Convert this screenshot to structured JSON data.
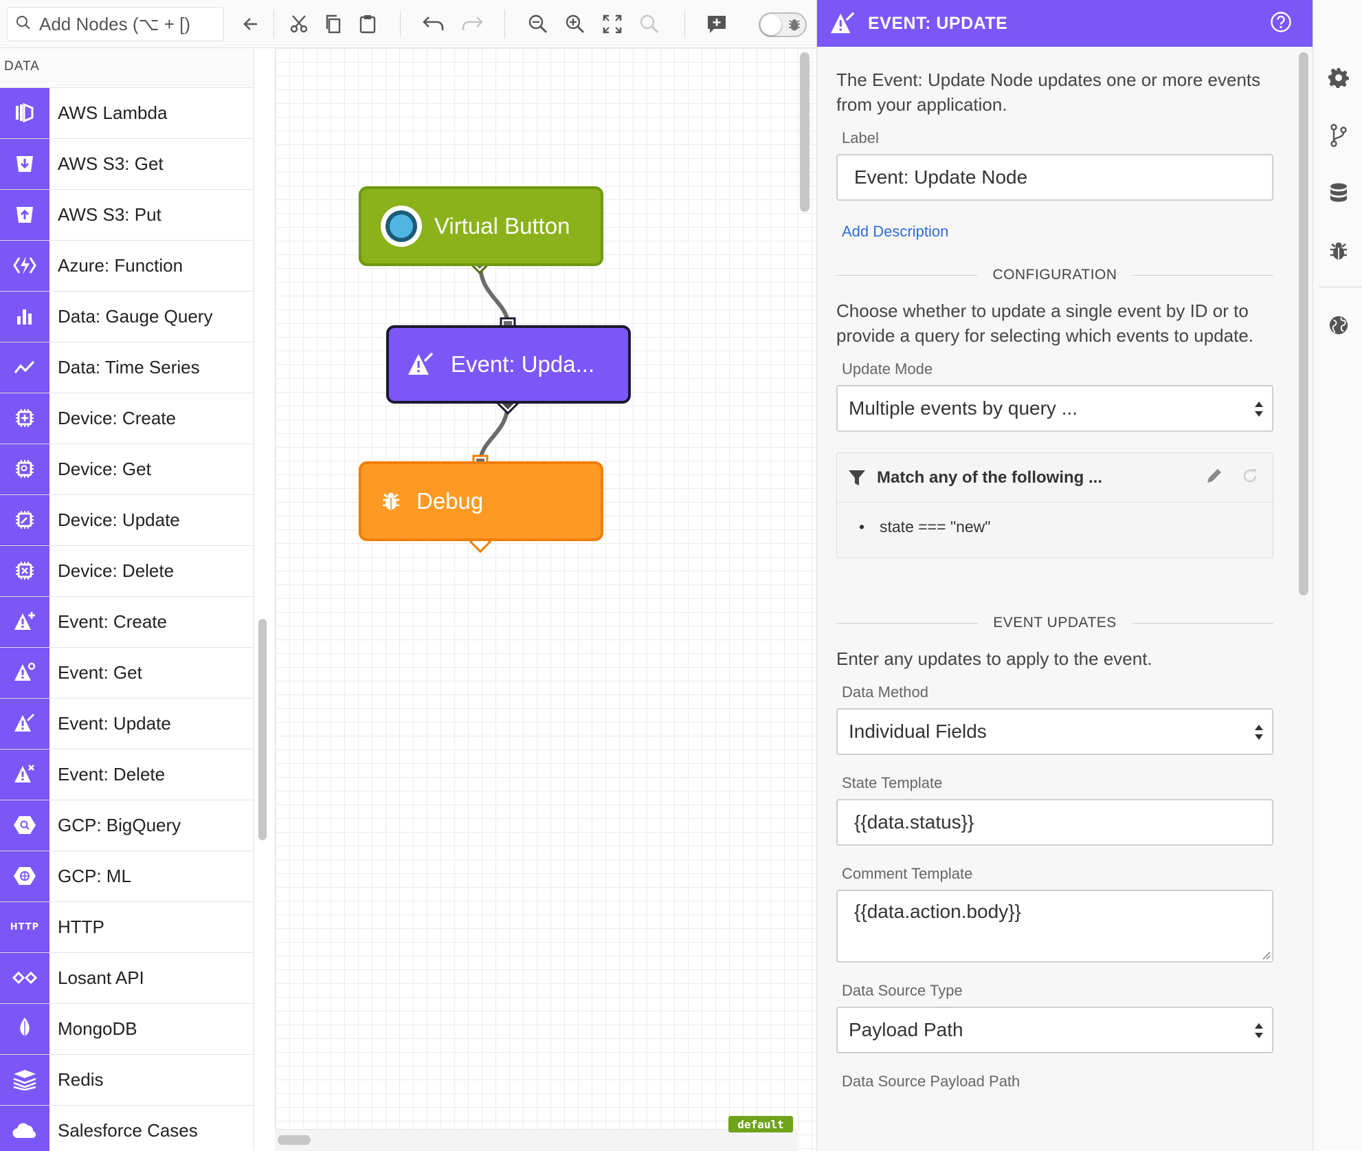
{
  "toolbar": {
    "search_placeholder": "Add Nodes (⌥ + [)"
  },
  "palette": {
    "header": "DATA",
    "items": [
      {
        "label": "AWS Lambda",
        "icon": "aws-lambda-icon"
      },
      {
        "label": "AWS S3: Get",
        "icon": "s3-get-icon"
      },
      {
        "label": "AWS S3: Put",
        "icon": "s3-put-icon"
      },
      {
        "label": "Azure: Function",
        "icon": "azure-function-icon"
      },
      {
        "label": "Data: Gauge Query",
        "icon": "bar-chart-icon"
      },
      {
        "label": "Data: Time Series",
        "icon": "line-chart-icon"
      },
      {
        "label": "Device: Create",
        "icon": "device-create-icon"
      },
      {
        "label": "Device: Get",
        "icon": "device-get-icon"
      },
      {
        "label": "Device: Update",
        "icon": "device-update-icon"
      },
      {
        "label": "Device: Delete",
        "icon": "device-delete-icon"
      },
      {
        "label": "Event: Create",
        "icon": "event-create-icon"
      },
      {
        "label": "Event: Get",
        "icon": "event-get-icon"
      },
      {
        "label": "Event: Update",
        "icon": "event-update-icon"
      },
      {
        "label": "Event: Delete",
        "icon": "event-delete-icon"
      },
      {
        "label": "GCP: BigQuery",
        "icon": "gcp-bigquery-icon"
      },
      {
        "label": "GCP: ML",
        "icon": "gcp-ml-icon"
      },
      {
        "label": "HTTP",
        "icon": "http-icon"
      },
      {
        "label": "Losant API",
        "icon": "losant-api-icon"
      },
      {
        "label": "MongoDB",
        "icon": "mongodb-icon"
      },
      {
        "label": "Redis",
        "icon": "redis-icon"
      },
      {
        "label": "Salesforce Cases",
        "icon": "salesforce-icon"
      }
    ],
    "icon_text": {
      "http": "HTTP"
    }
  },
  "canvas": {
    "nodes": [
      {
        "label": "Virtual Button",
        "color": "#8bb21a"
      },
      {
        "label": "Event: Upda...",
        "color": "#7b57f7"
      },
      {
        "label": "Debug",
        "color": "#fe9a24"
      }
    ],
    "version_tag": "default"
  },
  "panel": {
    "title": "EVENT: UPDATE",
    "accent": "#7b57f7",
    "description": "The Event: Update Node updates one or more events from your application.",
    "label_field": {
      "label": "Label",
      "value": "Event: Update Node"
    },
    "add_description": "Add Description",
    "configuration": {
      "heading": "CONFIGURATION",
      "description": "Choose whether to update a single event by ID or to provide a query for selecting which events to update.",
      "update_mode": {
        "label": "Update Mode",
        "value": "Multiple events by query ..."
      },
      "query": {
        "heading": "Match any of the following ...",
        "clause": "state === \"new\""
      }
    },
    "event_updates": {
      "heading": "EVENT UPDATES",
      "description": "Enter any updates to apply to the event.",
      "data_method": {
        "label": "Data Method",
        "value": "Individual Fields"
      },
      "state_template": {
        "label": "State Template",
        "value": "{{data.status}}"
      },
      "comment_template": {
        "label": "Comment Template",
        "value": "{{data.action.body}}"
      },
      "data_source_type": {
        "label": "Data Source Type",
        "value": "Payload Path"
      },
      "data_source_payload_path": {
        "label": "Data Source Payload Path"
      }
    }
  }
}
